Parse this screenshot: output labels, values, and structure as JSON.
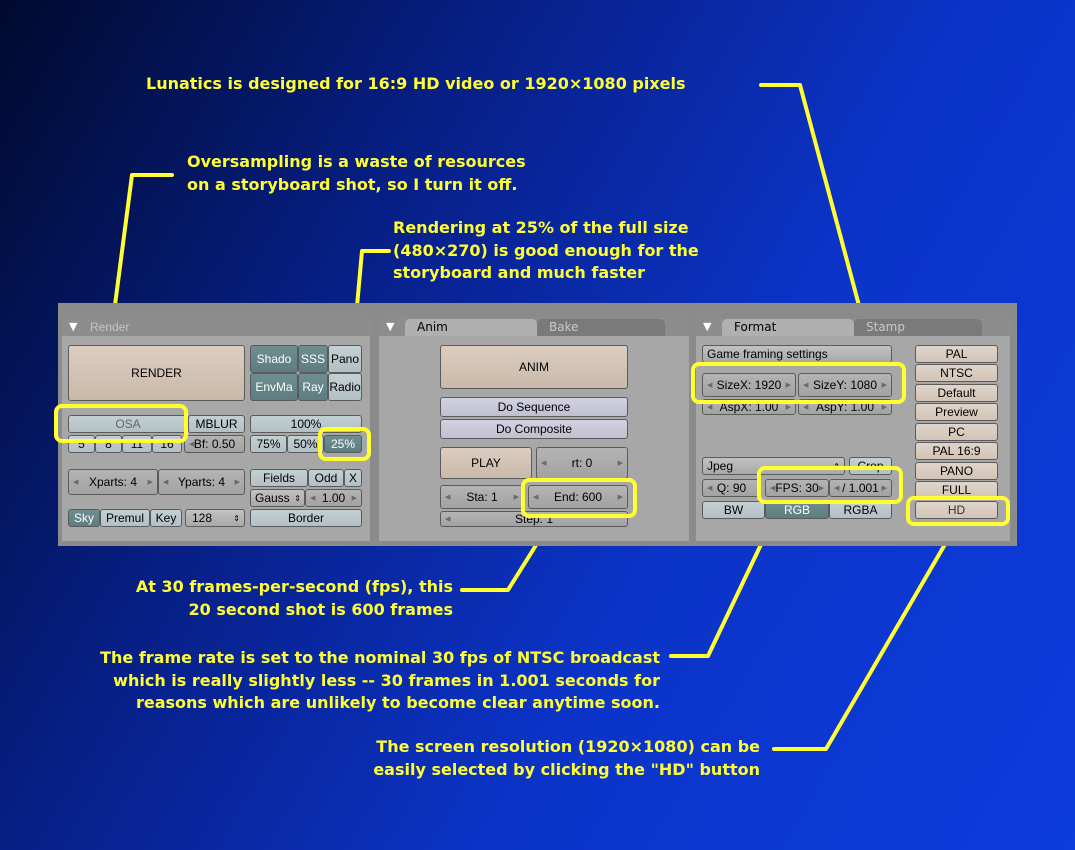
{
  "annotations": {
    "resolution_note": "Lunatics is designed for 16:9 HD video or 1920×1080 pixels",
    "osa_note": [
      "Oversampling is a waste of resources",
      "on a storyboard shot, so I turn it off."
    ],
    "scale_note": [
      "Rendering at 25% of the full size",
      "(480×270) is good enough for the",
      "storyboard and much faster"
    ],
    "frames_note": [
      "At 30 frames-per-second (fps), this",
      "20 second shot is 600 frames"
    ],
    "fps_note": [
      "The frame rate is set to the nominal 30 fps of NTSC broadcast",
      "which is really slightly less -- 30 frames in 1.001 seconds for",
      "reasons which are unlikely to become clear anytime soon."
    ],
    "hd_note": [
      "The screen resolution (1920×1080) can be",
      "easily selected by clicking the \"HD\" button"
    ]
  },
  "render_panel": {
    "header": "Render",
    "render_button": "RENDER",
    "shado": "Shado",
    "sss": "SSS",
    "pano": "Pano",
    "envma": "EnvMa",
    "ray": "Ray",
    "radio": "Radio",
    "osa": "OSA",
    "mblur": "MBLUR",
    "osa_levels": [
      "5",
      "8",
      "11",
      "16"
    ],
    "bf": "Bf: 0.50",
    "pct_100": "100%",
    "pct_75": "75%",
    "pct_50": "50%",
    "pct_25": "25%",
    "xparts": "Xparts: 4",
    "yparts": "Yparts: 4",
    "fields": "Fields",
    "odd": "Odd",
    "x": "X",
    "gauss": "Gauss",
    "gauss_value": "1.00",
    "sky": "Sky",
    "premul": "Premul",
    "key": "Key",
    "bits": "128",
    "border": "Border"
  },
  "anim_panel": {
    "tab_anim": "Anim",
    "tab_bake": "Bake",
    "anim_button": "ANIM",
    "do_sequence": "Do Sequence",
    "do_composite": "Do Composite",
    "play": "PLAY",
    "rt": "rt: 0",
    "sta": "Sta: 1",
    "end": "End: 600",
    "step": "Step: 1"
  },
  "format_panel": {
    "tab_format": "Format",
    "tab_stamp": "Stamp",
    "game_framing": "Game framing settings",
    "sizex": "SizeX: 1920",
    "sizey": "SizeY: 1080",
    "aspx": "AspX: 1.00",
    "aspy": "AspY: 1.00",
    "presets": [
      "PAL",
      "NTSC",
      "Default",
      "Preview",
      "PC",
      "PAL 16:9",
      "PANO",
      "FULL"
    ],
    "hd": "HD",
    "codec": "Jpeg",
    "crop": "Crop",
    "quality": "Q: 90",
    "fps": "FPS: 30",
    "fps_base": "/ 1.001",
    "bw": "BW",
    "rgb": "RGB",
    "rgba": "RGBA"
  },
  "colors": {
    "annotation": "#ffff33",
    "background_dark": "#000a2e",
    "background_light": "#0d3cdf"
  }
}
